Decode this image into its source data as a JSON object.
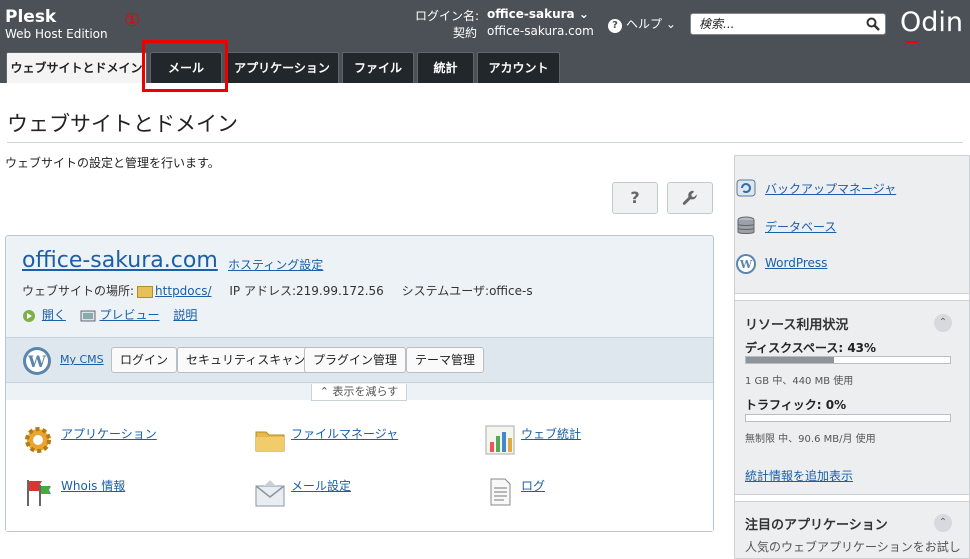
{
  "header": {
    "brand_line1": "Plesk",
    "brand_line2": "Web Host Edition",
    "annotation_marker": "①",
    "login_label": "ログイン名:",
    "login_user": "office-sakura",
    "login_chevron": "⌄",
    "contract_label": "契約",
    "contract_value": "office-sakura.com",
    "help_label": "ヘルプ",
    "help_chevron": "⌄",
    "search_placeholder": "検索...",
    "logo": "Odin"
  },
  "tabs": [
    {
      "label": "ウェブサイトとドメイン",
      "active": true
    },
    {
      "label": "メール",
      "active": false
    },
    {
      "label": "アプリケーション",
      "active": false
    },
    {
      "label": "ファイル",
      "active": false
    },
    {
      "label": "統計",
      "active": false
    },
    {
      "label": "アカウント",
      "active": false
    }
  ],
  "page": {
    "title": "ウェブサイトとドメイン",
    "description": "ウェブサイトの設定と管理を行います。",
    "help_glyph": "?",
    "tools_glyph": "🔧"
  },
  "site": {
    "domain": "office-sakura.com",
    "hosting_link": "ホスティング設定",
    "location_label": "ウェブサイトの場所:",
    "location_link": "httpdocs/",
    "ip_text": "IP アドレス:219.99.172.56",
    "sysuser_text": "システムユーザ:office-s",
    "open_link": "開く",
    "preview_link": "プレビュー",
    "description_link": "説明",
    "mycms_link": "My CMS",
    "buttons": [
      "ログイン",
      "セキュリティスキャン",
      "プラグイン管理",
      "テーマ管理"
    ],
    "reduce_label": "表示を減らす",
    "reduce_chevron": "⌃",
    "tools": [
      {
        "label": "アプリケーション",
        "icon": "gear-icon"
      },
      {
        "label": "ファイルマネージャ",
        "icon": "folder-icon"
      },
      {
        "label": "ウェブ統計",
        "icon": "stats-chart-icon"
      },
      {
        "label": "Whois 情報",
        "icon": "flags-icon"
      },
      {
        "label": "メール設定",
        "icon": "envelope-icon"
      },
      {
        "label": "ログ",
        "icon": "log-document-icon"
      }
    ]
  },
  "sidebar": {
    "links": [
      {
        "label": "バックアップマネージャ",
        "icon": "backup-icon"
      },
      {
        "label": "データベース",
        "icon": "database-icon"
      },
      {
        "label": "WordPress",
        "icon": "wordpress-icon"
      }
    ],
    "resources_title": "リソース利用状況",
    "collapse_glyph": "⌃",
    "disk_label": "ディスクスペース: 43%",
    "disk_percent": 43,
    "disk_sub": "1 GB 中、440 MB 使用",
    "traffic_label": "トラフィック: 0%",
    "traffic_percent": 0,
    "traffic_sub": "無制限 中、90.6 MB/月 使用",
    "add_stats_link": "統計情報を追加表示",
    "featured_title": "注目のアプリケーション",
    "featured_text": "人気のウェブアプリケーションをお試し"
  },
  "colors": {
    "topbar": "#4b5157",
    "tab_inactive": "#22272b",
    "link": "#1a5fa8",
    "highlight": "#ee0000"
  }
}
